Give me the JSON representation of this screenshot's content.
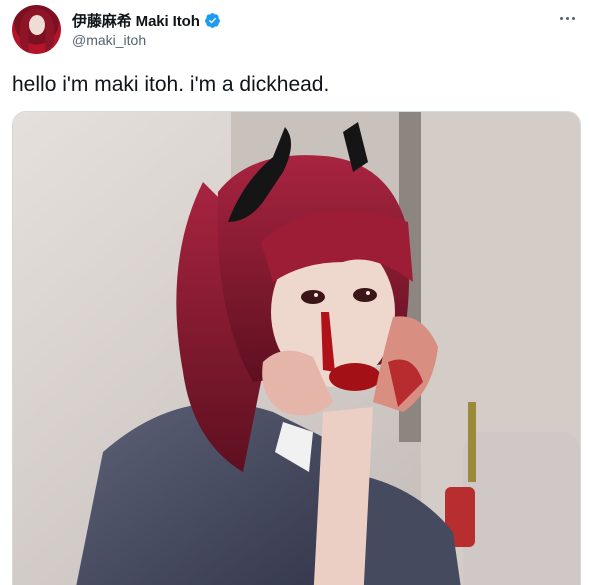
{
  "tweet": {
    "display_name": "伊藤麻希 Maki Itoh",
    "handle": "@maki_itoh",
    "verified": true,
    "text": "hello i'm maki itoh. i'm a dickhead.",
    "avatar_icon": "avatar-photo",
    "more_icon": "more-options-icon",
    "verified_icon": "verified-badge-icon",
    "media": {
      "type": "photo",
      "colors": {
        "hair": "#8e1b2e",
        "blood": "#b0121a",
        "wall": "#ddd6d1",
        "jacket": "#4a4e63",
        "skin": "#eed7cc"
      }
    },
    "colors": {
      "verified": "#1d9bf0",
      "text": "#0f1419",
      "muted": "#536471"
    }
  }
}
